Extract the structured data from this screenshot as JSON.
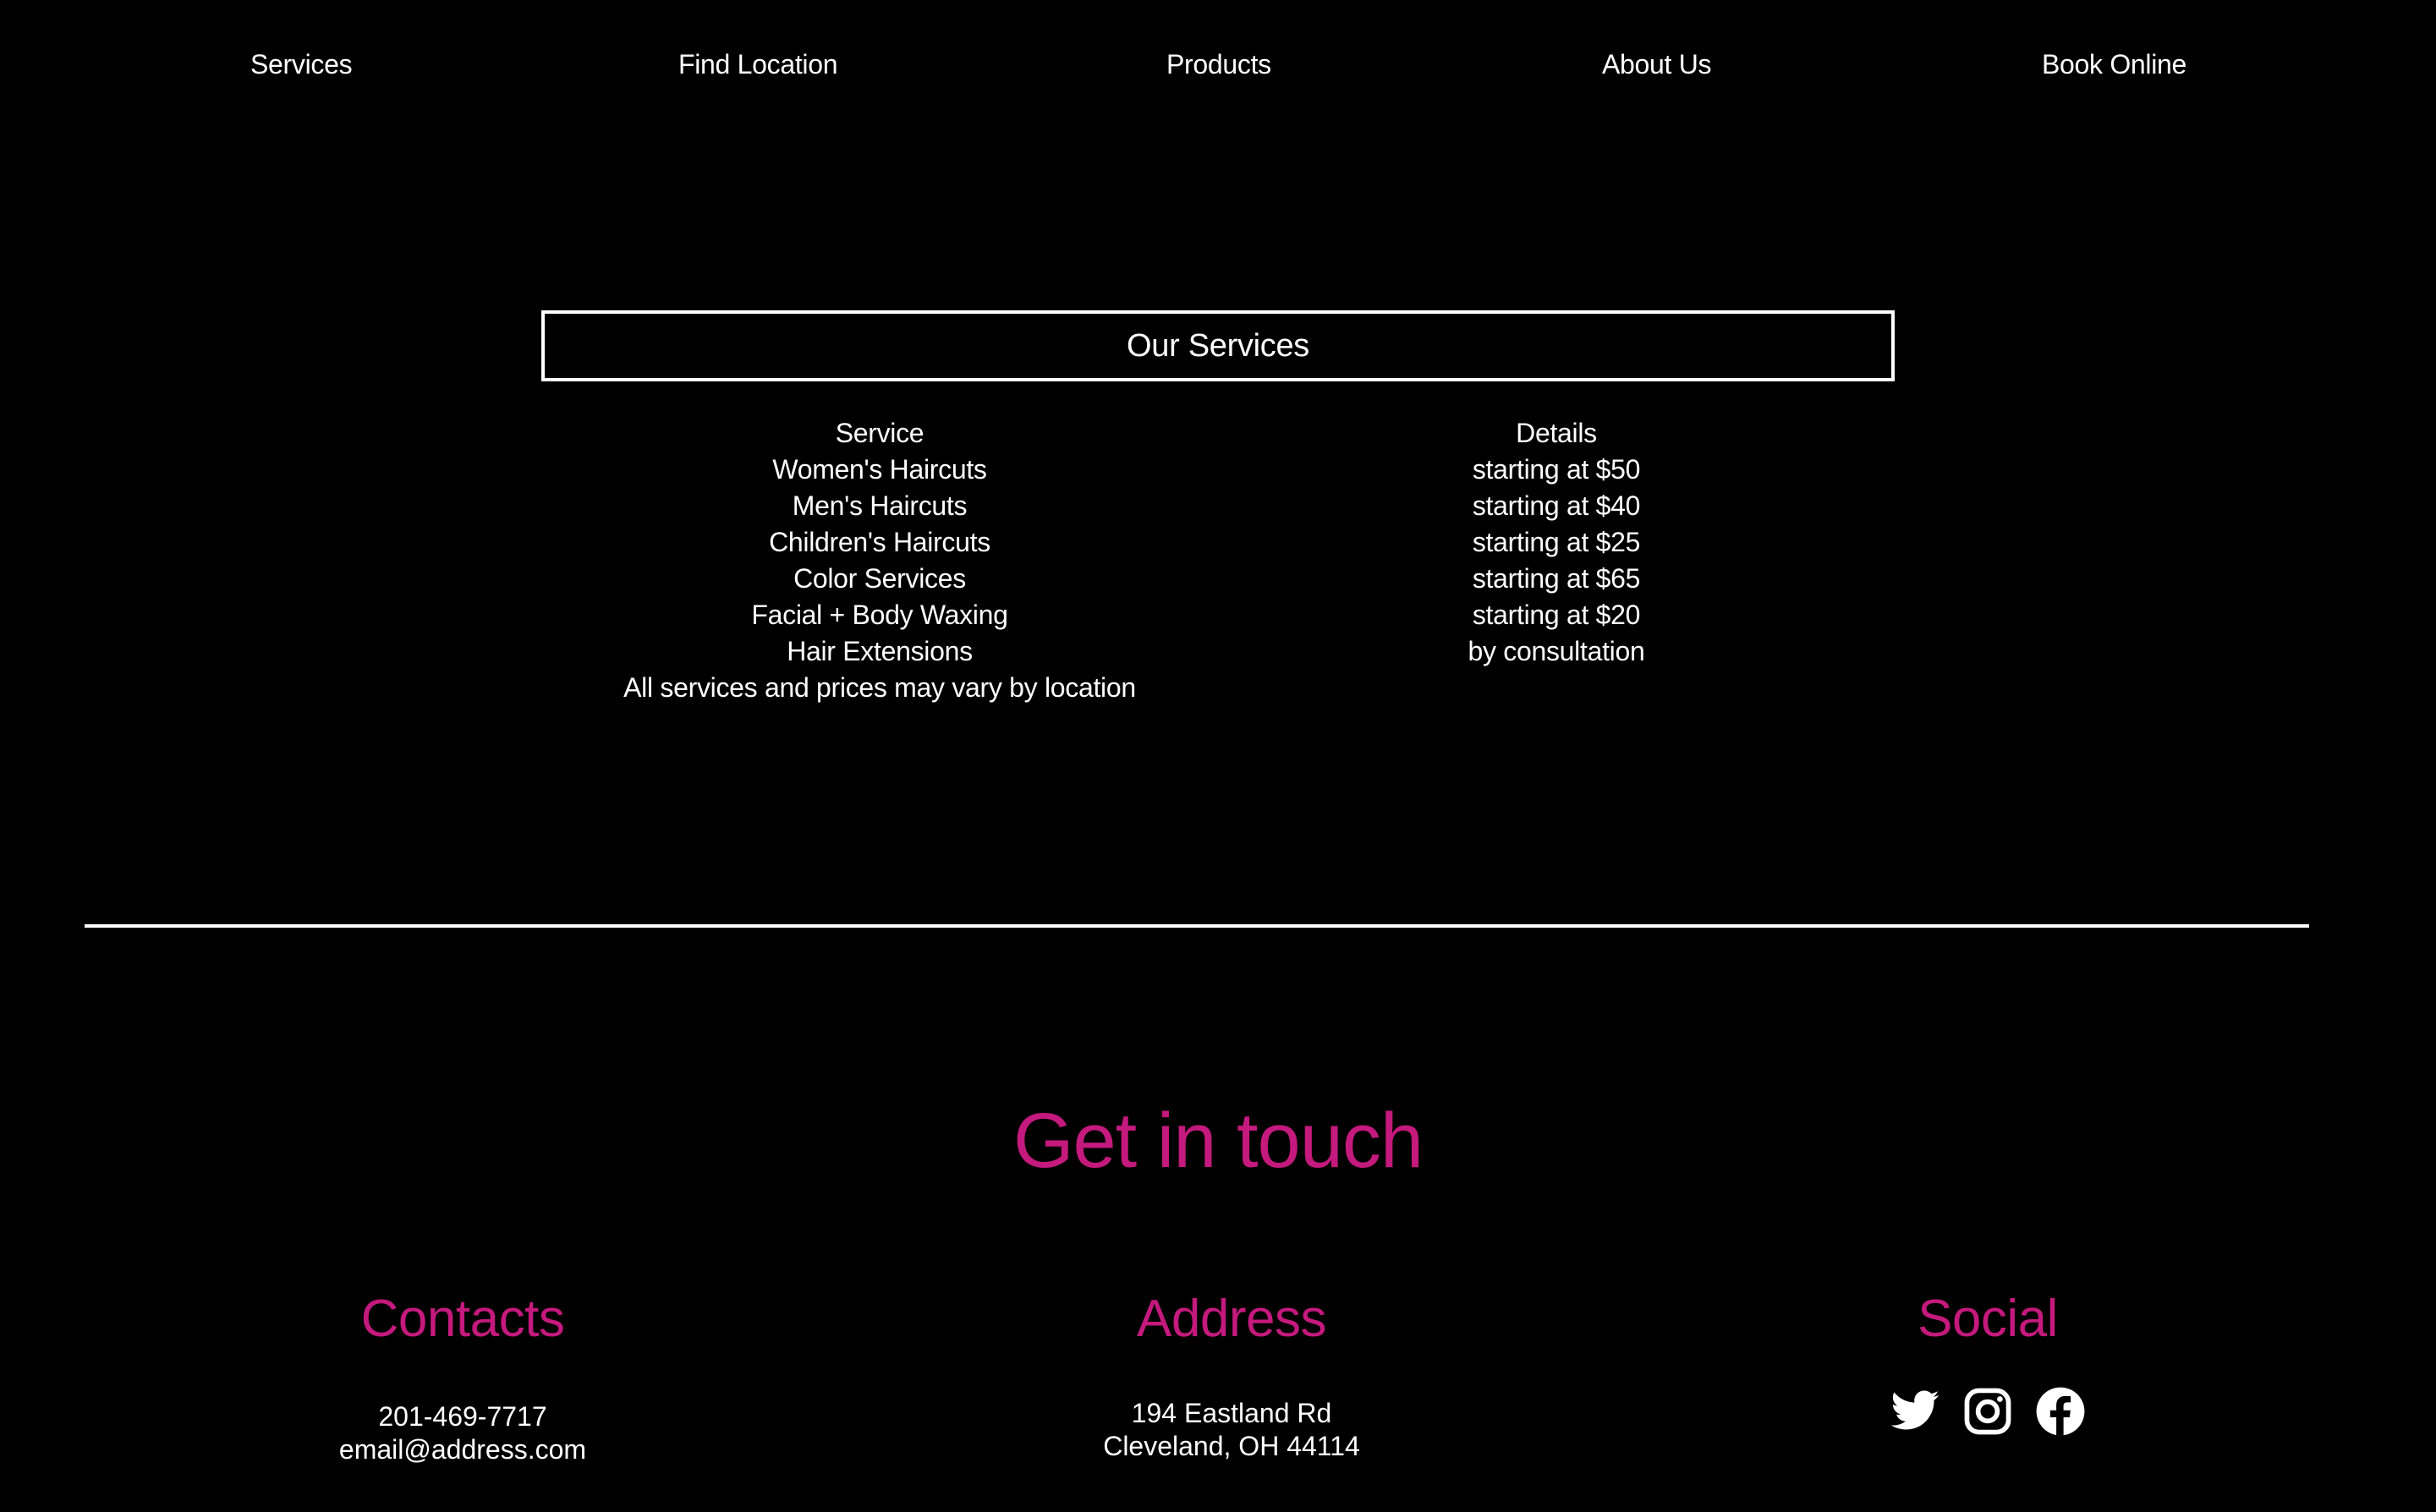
{
  "nav": {
    "items": [
      {
        "label": "Services"
      },
      {
        "label": "Find Location"
      },
      {
        "label": "Products"
      },
      {
        "label": "About Us"
      },
      {
        "label": "Book Online"
      }
    ]
  },
  "services": {
    "title": "Our Services",
    "service_header": "Service",
    "details_header": "Details",
    "rows": [
      {
        "service": "Women's Haircuts",
        "details": "starting at $50"
      },
      {
        "service": "Men's Haircuts",
        "details": "starting at $40"
      },
      {
        "service": "Children's Haircuts",
        "details": "starting at $25"
      },
      {
        "service": "Color Services",
        "details": "starting at $65"
      },
      {
        "service": "Facial + Body Waxing",
        "details": "starting at $20"
      },
      {
        "service": "Hair Extensions",
        "details": "by consultation"
      }
    ],
    "note": "All services and prices may vary by location"
  },
  "footer": {
    "heading": "Get in touch",
    "contacts": {
      "title": "Contacts",
      "phone": "201-469-7717",
      "email": "email@address.com"
    },
    "address": {
      "title": "Address",
      "line1": "194 Eastland Rd",
      "line2": "Cleveland, OH 44114"
    },
    "social": {
      "title": "Social",
      "icons": [
        "twitter-icon",
        "instagram-icon",
        "facebook-icon"
      ]
    }
  },
  "colors": {
    "background": "#000000",
    "text": "#ffffff",
    "accent": "#c4197d"
  }
}
